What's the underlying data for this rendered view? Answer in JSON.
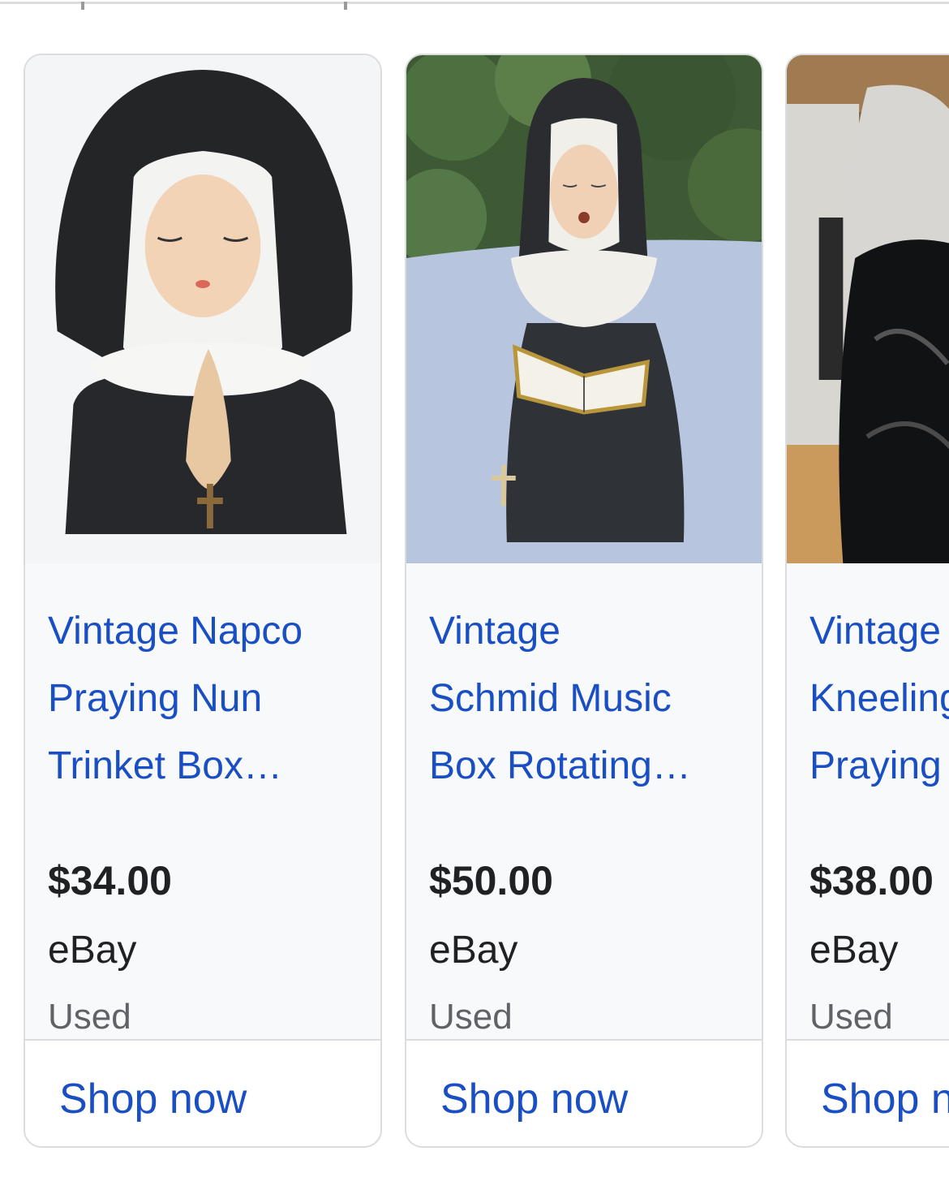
{
  "products": [
    {
      "title_lines": [
        "Vintage Napco",
        "Praying Nun",
        "Trinket Box…"
      ],
      "price": "$34.00",
      "seller": "eBay",
      "condition": "Used",
      "cta": "Shop now",
      "image_icon": "praying-nun-figurine-image"
    },
    {
      "title_lines": [
        "Vintage",
        "Schmid Music",
        "Box Rotating…"
      ],
      "price": "$50.00",
      "seller": "eBay",
      "condition": "Used",
      "cta": "Shop now",
      "image_icon": "singing-nun-figurine-image"
    },
    {
      "title_lines": [
        "Vintage",
        "Kneeling",
        "Praying"
      ],
      "price": "$38.00",
      "seller": "eBay",
      "condition": "Used",
      "cta": "Shop now",
      "image_icon": "kneeling-nun-figurine-image"
    }
  ],
  "colors": {
    "link": "#1a4fc4",
    "card_bg": "#f8f9fa",
    "border": "#dadce0"
  }
}
